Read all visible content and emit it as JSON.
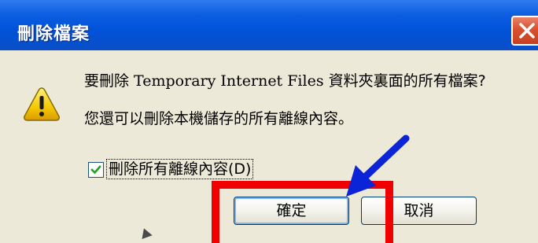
{
  "window": {
    "title": "刪除檔案",
    "close_icon": "close-x-icon"
  },
  "message": {
    "icon": "warning-icon",
    "line1_prefix": "要刪除 ",
    "line1_latin": "Temporary Internet Files",
    "line1_suffix": " 資料夾裏面的所有檔案?",
    "line2": "您還可以刪除本機儲存的所有離線內容。"
  },
  "checkbox": {
    "label": "刪除所有離線內容(D)",
    "checked": true
  },
  "buttons": {
    "ok_label": "確定",
    "cancel_label": "取消"
  },
  "annotations": {
    "highlight_color": "#f00000",
    "arrow_color": "#0b24d8"
  }
}
